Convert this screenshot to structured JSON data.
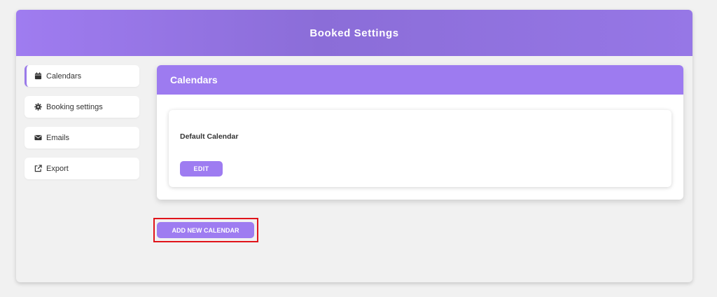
{
  "header": {
    "title": "Booked Settings"
  },
  "sidebar": {
    "items": [
      {
        "label": "Calendars",
        "icon": "calendar-icon",
        "active": true
      },
      {
        "label": "Booking settings",
        "icon": "gear-icon",
        "active": false
      },
      {
        "label": "Emails",
        "icon": "envelope-icon",
        "active": false
      },
      {
        "label": "Export",
        "icon": "external-link-icon",
        "active": false
      }
    ]
  },
  "main": {
    "title": "Calendars",
    "calendar": {
      "name": "Default Calendar",
      "edit_label": "EDIT"
    },
    "add_label": "ADD NEW CALENDAR"
  },
  "colors": {
    "accent": "#9e7cf1",
    "highlight": "#e0141a"
  }
}
